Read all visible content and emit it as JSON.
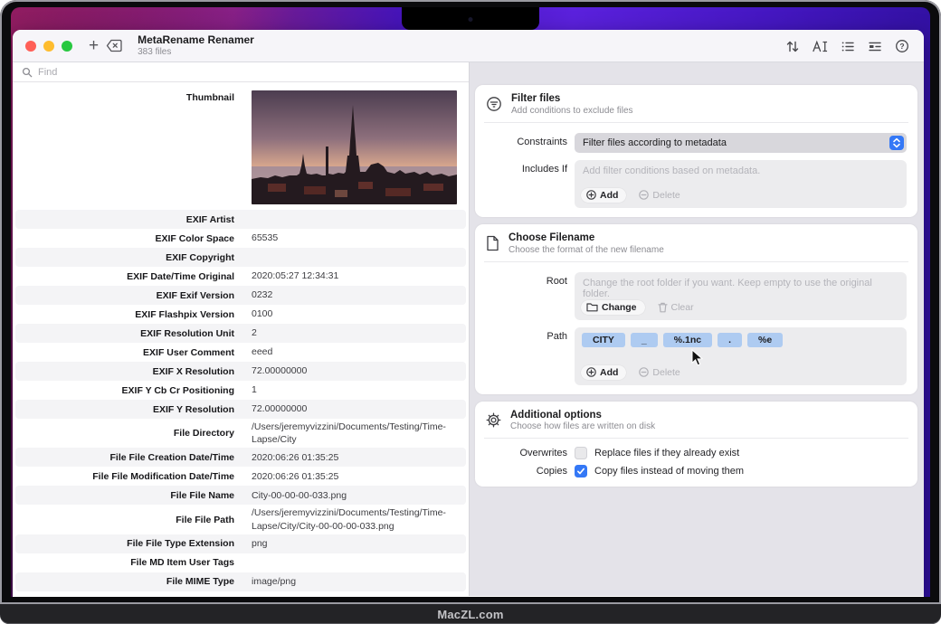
{
  "device": {
    "brand": "MacZL.com"
  },
  "window": {
    "title": "MetaRename Renamer",
    "file_count": "383 files",
    "search_placeholder": "Find",
    "toolbar_icons": [
      "sort-icon",
      "rename-text-icon",
      "list-icon",
      "grouped-list-icon",
      "help-icon"
    ],
    "traffic_lights": [
      "close",
      "minimize",
      "zoom"
    ]
  },
  "metadata": {
    "thumbnail_label": "Thumbnail",
    "rows": [
      {
        "label": "EXIF Artist",
        "value": ""
      },
      {
        "label": "EXIF Color Space",
        "value": "65535"
      },
      {
        "label": "EXIF Copyright",
        "value": ""
      },
      {
        "label": "EXIF Date/Time Original",
        "value": "2020:05:27 12:34:31"
      },
      {
        "label": "EXIF Exif Version",
        "value": "0232"
      },
      {
        "label": "EXIF Flashpix Version",
        "value": "0100"
      },
      {
        "label": "EXIF Resolution Unit",
        "value": "2"
      },
      {
        "label": "EXIF User Comment",
        "value": "eeed"
      },
      {
        "label": "EXIF X Resolution",
        "value": "72.00000000"
      },
      {
        "label": "EXIF Y Cb Cr Positioning",
        "value": "1"
      },
      {
        "label": "EXIF Y Resolution",
        "value": "72.00000000"
      },
      {
        "label": "File Directory",
        "value": "/Users/jeremyvizzini/Documents/Testing/Time-Lapse/City"
      },
      {
        "label": "File File Creation Date/Time",
        "value": "2020:06:26 01:35:25"
      },
      {
        "label": "File File Modification Date/Time",
        "value": "2020:06:26 01:35:25"
      },
      {
        "label": "File File Name",
        "value": "City-00-00-00-033.png"
      },
      {
        "label": "File File Path",
        "value": "/Users/jeremyvizzini/Documents/Testing/Time-Lapse/City/City-00-00-00-033.png"
      },
      {
        "label": "File File Type Extension",
        "value": "png"
      },
      {
        "label": "File MD Item User Tags",
        "value": ""
      },
      {
        "label": "File MIME Type",
        "value": "image/png"
      }
    ]
  },
  "filter_card": {
    "title": "Filter files",
    "subtitle": "Add conditions to exclude files",
    "constraints_label": "Constraints",
    "constraints_value": "Filter files according to metadata",
    "includes_label": "Includes If",
    "includes_placeholder": "Add filter conditions based on metadata.",
    "add_label": "Add",
    "delete_label": "Delete"
  },
  "filename_card": {
    "title": "Choose Filename",
    "subtitle": "Choose the format of the new filename",
    "root_label": "Root",
    "root_placeholder": "Change the root folder if you want. Keep empty to use the original folder.",
    "change_label": "Change",
    "clear_label": "Clear",
    "path_label": "Path",
    "path_tokens": [
      "CITY",
      "_",
      "%.1nc",
      ".",
      "%e"
    ],
    "add_label": "Add",
    "delete_label": "Delete"
  },
  "options_card": {
    "title": "Additional options",
    "subtitle": "Choose how files are written on disk",
    "overwrites_label": "Overwrites",
    "overwrites_text": "Replace files if they already exist",
    "overwrites_checked": false,
    "copies_label": "Copies",
    "copies_text": "Copy files instead of moving them",
    "copies_checked": true
  },
  "colors": {
    "accent_blue": "#3478f6",
    "token_blue": "#aecbf1",
    "wallpaper_purple": "#5b21dd"
  }
}
